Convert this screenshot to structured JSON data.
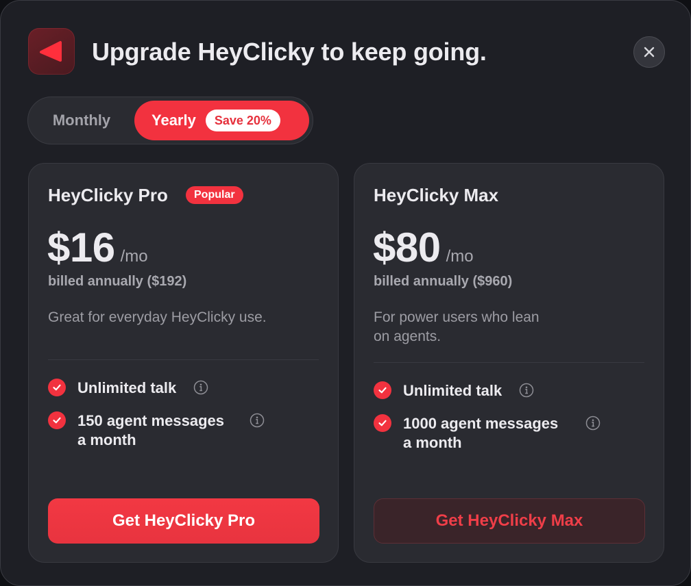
{
  "header": {
    "title": "Upgrade HeyClicky to keep going.",
    "logo_icon": "play-triangle-icon",
    "close_icon": "close-icon"
  },
  "billing_toggle": {
    "monthly_label": "Monthly",
    "yearly_label": "Yearly",
    "save_badge": "Save 20%",
    "selected": "Yearly"
  },
  "plans": [
    {
      "name": "HeyClicky Pro",
      "badge": "Popular",
      "price": "$16",
      "period": "/mo",
      "billed": "billed annually ($192)",
      "description": "Great for everyday HeyClicky use.",
      "features": [
        {
          "line1": "Unlimited talk",
          "line2": ""
        },
        {
          "line1": "150 agent messages",
          "line2": "a month"
        }
      ],
      "cta": "Get HeyClicky Pro"
    },
    {
      "name": "HeyClicky Max",
      "badge": "",
      "price": "$80",
      "period": "/mo",
      "billed": "billed annually ($960)",
      "description_line1": "For power users who lean",
      "description_line2": "on agents.",
      "features": [
        {
          "line1": "Unlimited talk",
          "line2": ""
        },
        {
          "line1": "1000 agent messages",
          "line2": "a month"
        }
      ],
      "cta": "Get HeyClicky Max"
    }
  ],
  "colors": {
    "accent": "#f2323f",
    "background": "#1e1f25",
    "card": "#2a2b31"
  }
}
